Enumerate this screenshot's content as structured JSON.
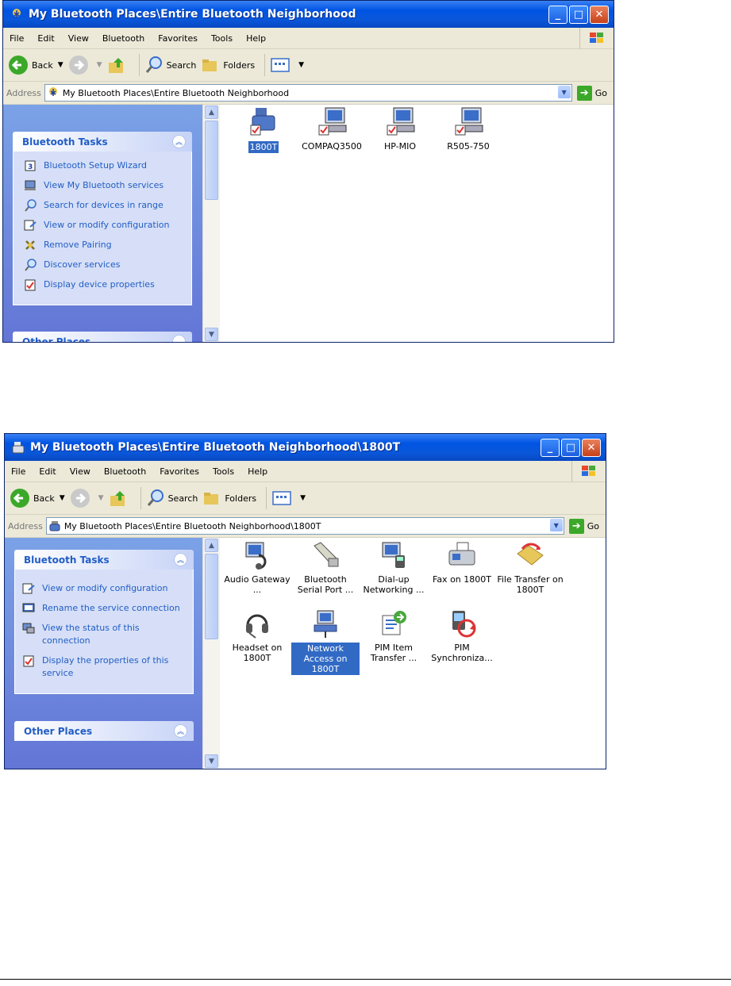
{
  "windows": [
    {
      "title": "My Bluetooth Places\\Entire Bluetooth Neighborhood",
      "menu": [
        "File",
        "Edit",
        "View",
        "Bluetooth",
        "Favorites",
        "Tools",
        "Help"
      ],
      "toolbar": {
        "back": "Back",
        "search": "Search",
        "folders": "Folders"
      },
      "address": {
        "label": "Address",
        "value": "My Bluetooth Places\\Entire Bluetooth Neighborhood",
        "go": "Go"
      },
      "task_panel": {
        "title": "Bluetooth Tasks",
        "tasks": [
          "Bluetooth Setup Wizard",
          "View My Bluetooth services",
          "Search for devices in range",
          "View or modify configuration",
          "Remove Pairing",
          "Discover services",
          "Display device properties"
        ]
      },
      "other_panel": {
        "title": "Other Places"
      },
      "items": [
        {
          "label": "1800T",
          "selected": true,
          "icon": "bluetooth-device-icon"
        },
        {
          "label": "COMPAQ3500",
          "selected": false,
          "icon": "computer-icon"
        },
        {
          "label": "HP-MIO",
          "selected": false,
          "icon": "computer-icon"
        },
        {
          "label": "R505-750",
          "selected": false,
          "icon": "computer-icon"
        }
      ]
    },
    {
      "title": "My Bluetooth Places\\Entire Bluetooth Neighborhood\\1800T",
      "menu": [
        "File",
        "Edit",
        "View",
        "Bluetooth",
        "Favorites",
        "Tools",
        "Help"
      ],
      "toolbar": {
        "back": "Back",
        "search": "Search",
        "folders": "Folders"
      },
      "address": {
        "label": "Address",
        "value": "My Bluetooth Places\\Entire Bluetooth Neighborhood\\1800T",
        "go": "Go"
      },
      "task_panel": {
        "title": "Bluetooth Tasks",
        "tasks": [
          "View or modify configuration",
          "Rename the service connection",
          "View the status of this connection",
          "Display the properties of this service"
        ]
      },
      "other_panel": {
        "title": "Other Places"
      },
      "items": [
        {
          "label": "Audio Gateway ...",
          "selected": false,
          "icon": "audio-gateway-icon"
        },
        {
          "label": "Bluetooth Serial Port ...",
          "selected": false,
          "icon": "serial-port-icon"
        },
        {
          "label": "Dial-up Networking ...",
          "selected": false,
          "icon": "dialup-icon"
        },
        {
          "label": "Fax on 1800T",
          "selected": false,
          "icon": "fax-icon"
        },
        {
          "label": "File Transfer on 1800T",
          "selected": false,
          "icon": "file-transfer-icon"
        },
        {
          "label": "Headset on 1800T",
          "selected": false,
          "icon": "headset-icon"
        },
        {
          "label": "Network Access on 1800T",
          "selected": true,
          "icon": "network-access-icon"
        },
        {
          "label": "PIM Item Transfer ...",
          "selected": false,
          "icon": "pim-transfer-icon"
        },
        {
          "label": "PIM Synchroniza...",
          "selected": false,
          "icon": "pim-sync-icon"
        }
      ]
    }
  ]
}
